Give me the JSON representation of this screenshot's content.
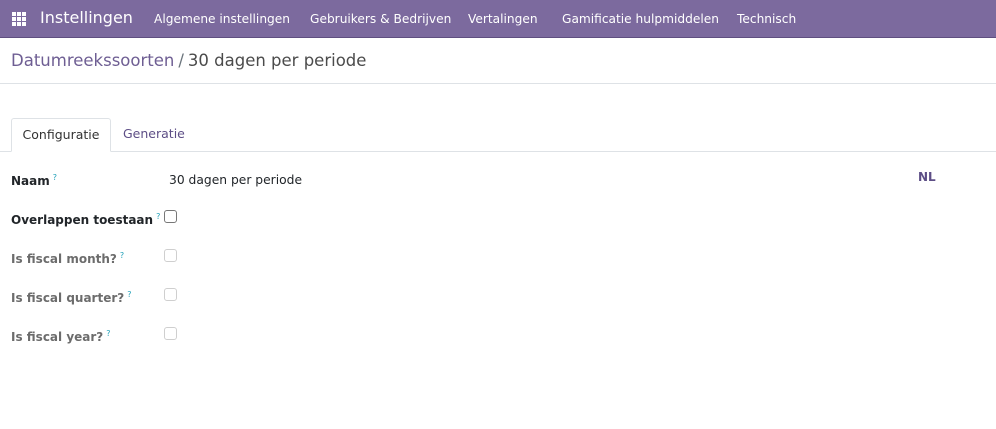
{
  "navbar": {
    "brand": "Instellingen",
    "menu": [
      "Algemene instellingen",
      "Gebruikers & Bedrijven",
      "Vertalingen",
      "Gamificatie hulpmiddelen",
      "Technisch"
    ]
  },
  "breadcrumb": {
    "parent": "Datumreekssoorten",
    "separator": "/",
    "current": "30 dagen per periode"
  },
  "tabs": [
    "Configuratie",
    "Generatie"
  ],
  "form": {
    "name_label": "Naam",
    "name_value": "30 dagen per periode",
    "lang_button": "NL",
    "help_mark": "?",
    "fields": [
      {
        "label": "Overlappen toestaan",
        "checked": false,
        "editable": true
      },
      {
        "label": "Is fiscal month?",
        "checked": false,
        "editable": false
      },
      {
        "label": "Is fiscal quarter?",
        "checked": false,
        "editable": false
      },
      {
        "label": "Is fiscal year?",
        "checked": false,
        "editable": false
      }
    ]
  },
  "colors": {
    "navbar": "#7c6a9e",
    "accent": "#5d4e86",
    "help": "#20a0b8"
  }
}
